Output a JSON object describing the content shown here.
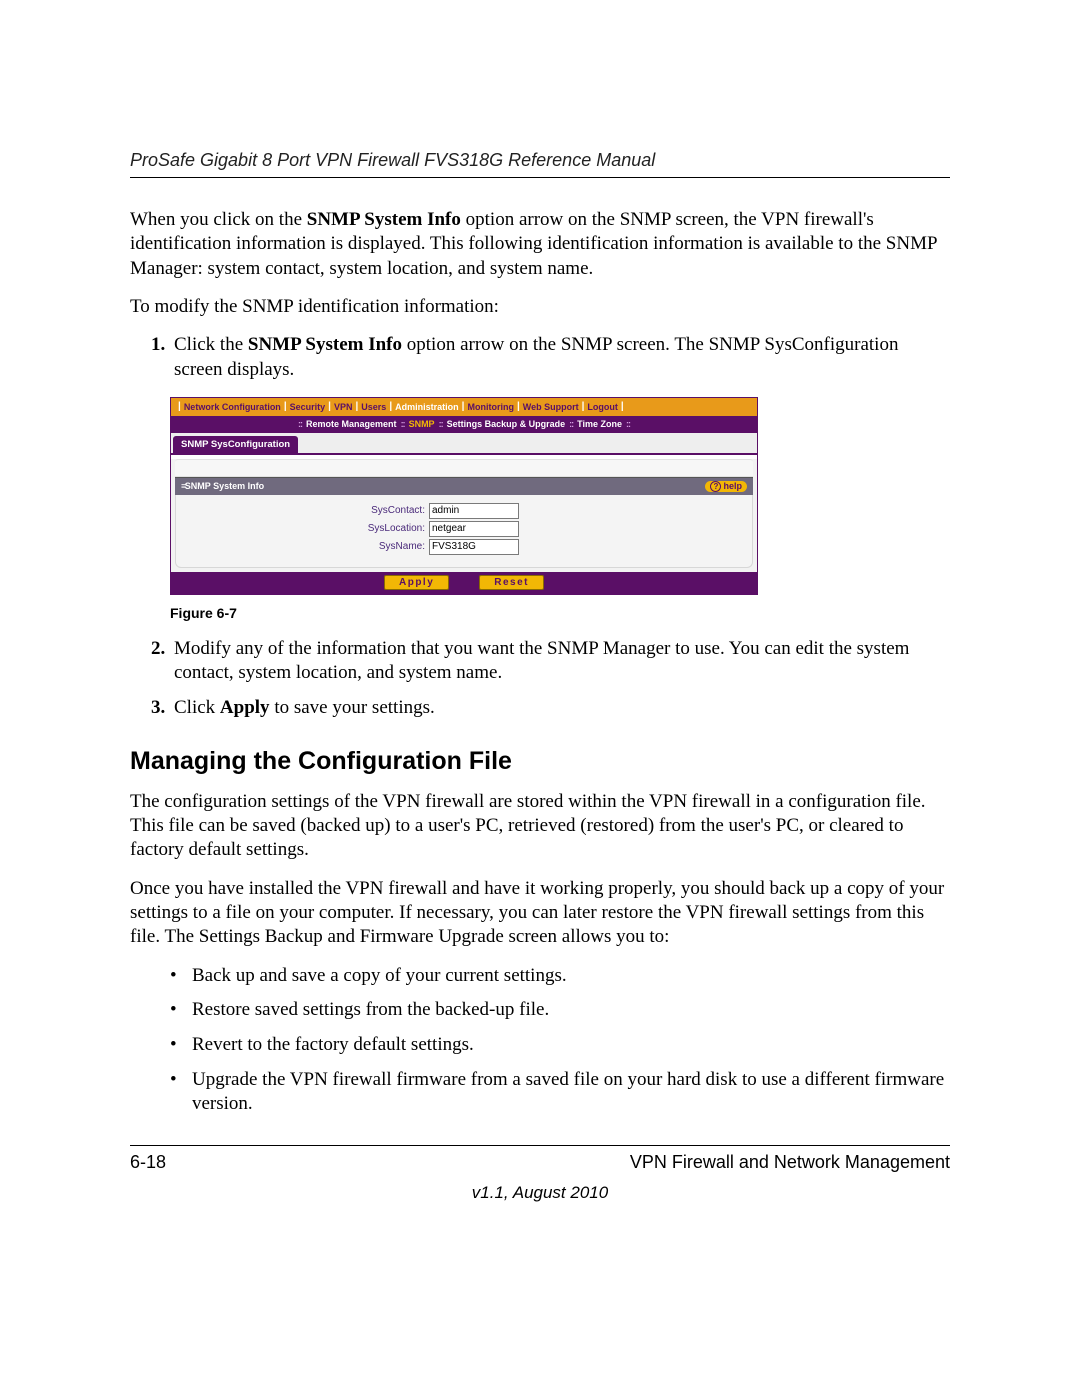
{
  "header": {
    "running_title": "ProSafe Gigabit 8 Port VPN Firewall FVS318G Reference Manual"
  },
  "intro": {
    "p1_a": "When you click on the ",
    "p1_bold": "SNMP System Info",
    "p1_b": " option arrow on the SNMP screen, the VPN firewall's identification information is displayed. This following identification information is available to the SNMP Manager: system contact, system location, and system name.",
    "p2": "To modify the SNMP identification information:"
  },
  "steps_top": {
    "s1_a": "Click the ",
    "s1_bold": "SNMP System Info",
    "s1_b": " option arrow on the SNMP screen. The SNMP SysConfiguration screen displays."
  },
  "ui": {
    "topnav": [
      "Network Configuration",
      "Security",
      "VPN",
      "Users",
      "Administration",
      "Monitoring",
      "Web Support",
      "Logout"
    ],
    "topnav_active_index": 4,
    "subnav": [
      "Remote Management",
      "SNMP",
      "Settings Backup & Upgrade",
      "Time Zone"
    ],
    "subnav_active_index": 1,
    "tab_label": "SNMP SysConfiguration",
    "section_title": "SNMP System Info",
    "help_label": "help",
    "fields": {
      "syscontact_label": "SysContact:",
      "syscontact_value": "admin",
      "syslocation_label": "SysLocation:",
      "syslocation_value": "netgear",
      "sysname_label": "SysName:",
      "sysname_value": "FVS318G"
    },
    "buttons": {
      "apply": "Apply",
      "reset": "Reset"
    }
  },
  "figure_caption": "Figure 6-7",
  "steps_bottom": {
    "s2": "Modify any of the information that you want the SNMP Manager to use. You can edit the system contact, system location, and system name.",
    "s3_a": "Click ",
    "s3_bold": "Apply",
    "s3_b": " to save your settings."
  },
  "section2": {
    "heading": "Managing the Configuration File",
    "p1": "The configuration settings of the VPN firewall are stored within the VPN firewall in a configuration file. This file can be saved (backed up) to a user's PC, retrieved (restored) from the user's PC, or cleared to factory default settings.",
    "p2": "Once you have installed the VPN firewall and have it working properly, you should back up a copy of your settings to a file on your computer. If necessary, you can later restore the VPN firewall settings from this file. The Settings Backup and Firmware Upgrade screen allows you to:",
    "bullets": [
      "Back up and save a copy of your current settings.",
      "Restore saved settings from the backed-up file.",
      "Revert to the factory default settings.",
      "Upgrade the VPN firewall firmware from a saved file on your hard disk to use a different firmware version."
    ]
  },
  "footer": {
    "page_number": "6-18",
    "chapter": "VPN Firewall and Network Management",
    "version": "v1.1, August 2010"
  }
}
